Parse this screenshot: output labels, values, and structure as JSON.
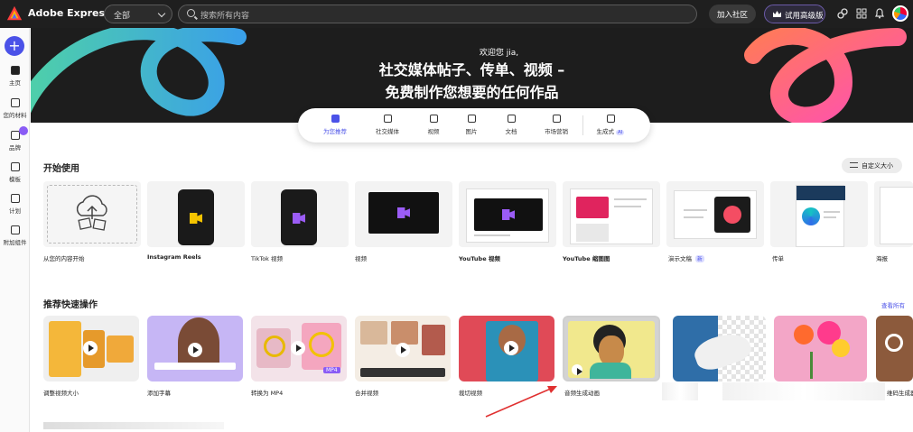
{
  "app": {
    "brand": "Adobe Express"
  },
  "header": {
    "scope_value": "全部",
    "search_placeholder": "搜索所有内容",
    "join_label": "加入社区",
    "trial_label": "试用高级版"
  },
  "sidebar": {
    "items": [
      {
        "label": "主页"
      },
      {
        "label": "您的材料"
      },
      {
        "label": "品牌"
      },
      {
        "label": "模板"
      },
      {
        "label": "计划"
      },
      {
        "label": "附加组件"
      }
    ]
  },
  "hero": {
    "welcome": "欢迎您 jia,",
    "line1": "社交媒体帖子、传单、视频 –",
    "line2": "免费制作您想要的任何作品"
  },
  "categories": [
    {
      "label": "为您推荐",
      "icon": "star-icon"
    },
    {
      "label": "社交媒体",
      "icon": "thumbs-up-icon"
    },
    {
      "label": "视频",
      "icon": "video-icon"
    },
    {
      "label": "图片",
      "icon": "image-icon"
    },
    {
      "label": "文档",
      "icon": "document-icon"
    },
    {
      "label": "市场营销",
      "icon": "megaphone-icon"
    },
    {
      "label": "生成式",
      "icon": "generate-icon",
      "badge": "AI"
    }
  ],
  "get_started": {
    "title": "开始使用",
    "custom_size": "自定义大小",
    "cards": [
      {
        "label": "从您的内容开始"
      },
      {
        "label": "Instagram Reels"
      },
      {
        "label": "TikTok 视频"
      },
      {
        "label": "视频"
      },
      {
        "label": "YouTube 视频"
      },
      {
        "label": "YouTube 缩图图"
      },
      {
        "label": "演示文稿",
        "badge": "新"
      },
      {
        "label": "传单"
      },
      {
        "label": "海报"
      }
    ]
  },
  "quick_actions": {
    "title": "推荐快速操作",
    "view_all": "查看所有",
    "items": [
      {
        "label": "调整视频大小"
      },
      {
        "label": "添加字幕"
      },
      {
        "label": "转换为 MP4",
        "tag": "MP4"
      },
      {
        "label": "合并视频"
      },
      {
        "label": "裁切视频"
      },
      {
        "label": "音频生成动画"
      },
      {
        "label": ""
      },
      {
        "label": ""
      },
      {
        "label": "维码生成器"
      }
    ]
  },
  "colors": {
    "accent": "#4b52e8",
    "dark": "#1f1f1f",
    "annotation": "#e03030"
  }
}
